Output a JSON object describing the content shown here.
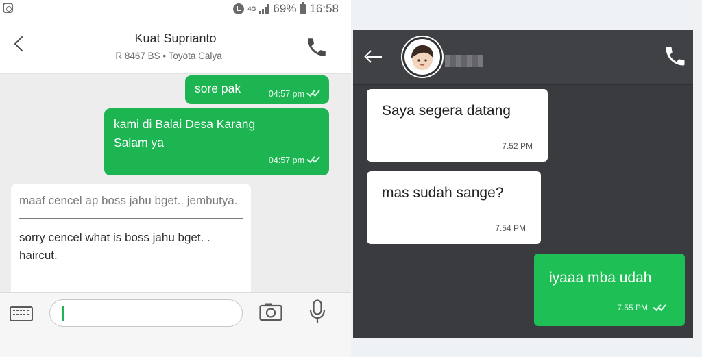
{
  "left": {
    "status_bar": {
      "network": "4G",
      "battery": "69%",
      "time": "16:58"
    },
    "header": {
      "name": "Kuat Suprianto",
      "subtitle": "R 8467 BS • Toyota Calya"
    },
    "messages": [
      {
        "text": "sore pak",
        "time": "04:57 pm",
        "sender": "me"
      },
      {
        "text": "kami di Balai Desa Karang Salam ya",
        "time": "04:57 pm",
        "sender": "me"
      }
    ],
    "incoming": {
      "original": "maaf cencel ap boss jahu bget.. jembutya.",
      "translation": "sorry cencel what is boss jahu bget. . haircut."
    },
    "input": {
      "value": ""
    }
  },
  "right": {
    "messages": [
      {
        "text": "Saya segera datang",
        "time": "7.52 PM",
        "sender": "them"
      },
      {
        "text": "mas sudah sange?",
        "time": "7.54 PM",
        "sender": "them"
      },
      {
        "text": "iyaaa mba udah",
        "time": "7.55 PM",
        "sender": "me"
      }
    ]
  },
  "colors": {
    "green": "#1db551",
    "dark_bg": "#3a3b3f"
  }
}
